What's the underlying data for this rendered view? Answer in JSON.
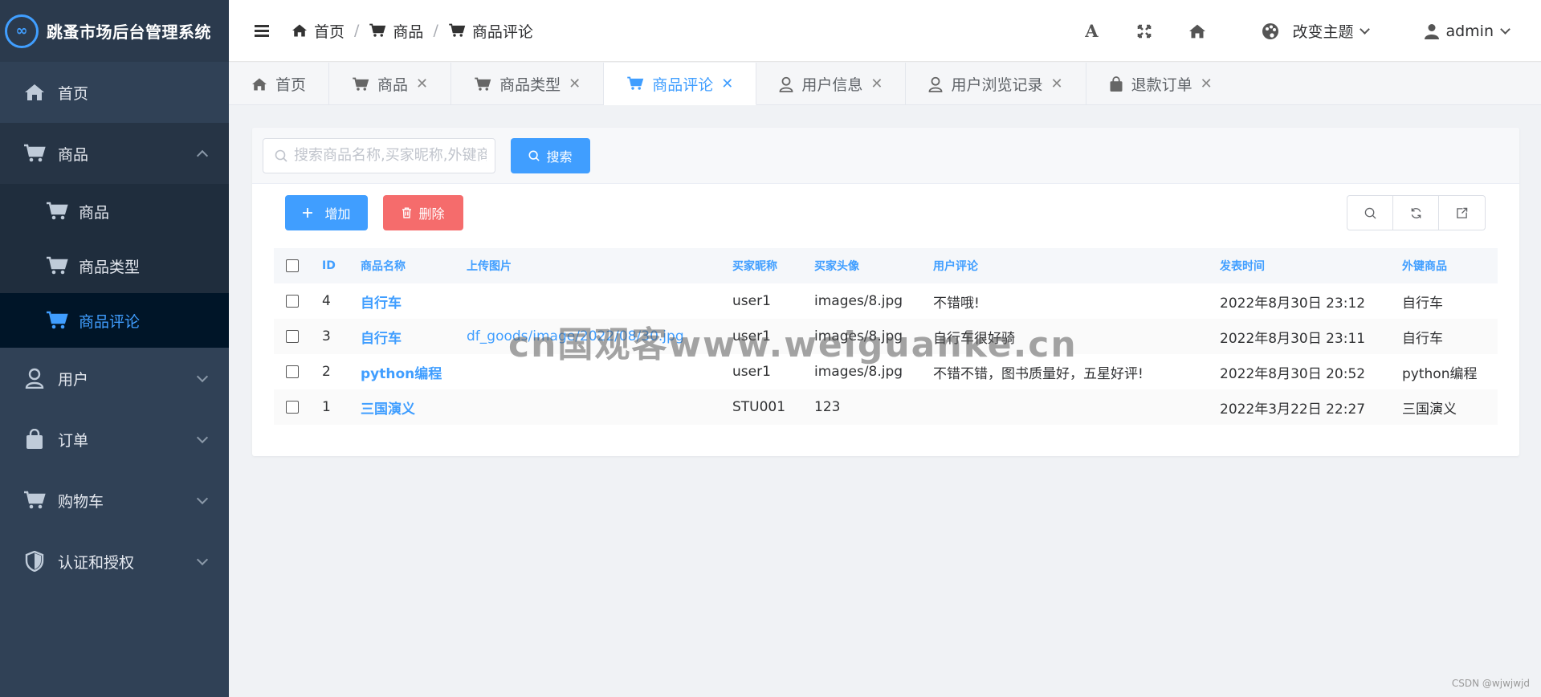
{
  "app": {
    "title": "跳蚤市场后台管理系统",
    "logo": "∞"
  },
  "sidebar": {
    "items": [
      {
        "label": "首页",
        "icon": "home-icon"
      },
      {
        "label": "商品",
        "icon": "cart-icon",
        "expanded": true,
        "children": [
          {
            "label": "商品",
            "icon": "cart-icon"
          },
          {
            "label": "商品类型",
            "icon": "cart-icon"
          },
          {
            "label": "商品评论",
            "icon": "cart-icon",
            "active": true
          }
        ]
      },
      {
        "label": "用户",
        "icon": "user-icon"
      },
      {
        "label": "订单",
        "icon": "bag-icon"
      },
      {
        "label": "购物车",
        "icon": "cart-icon"
      },
      {
        "label": "认证和授权",
        "icon": "shield-icon"
      }
    ]
  },
  "header": {
    "breadcrumb": [
      "首页",
      "商品",
      "商品评论"
    ],
    "theme_label": "改变主题",
    "user_label": "admin"
  },
  "tabs": [
    {
      "label": "首页",
      "icon": "home-icon",
      "closable": false
    },
    {
      "label": "商品",
      "icon": "cart-icon",
      "closable": true
    },
    {
      "label": "商品类型",
      "icon": "cart-icon",
      "closable": true
    },
    {
      "label": "商品评论",
      "icon": "cart-icon",
      "closable": true,
      "active": true
    },
    {
      "label": "用户信息",
      "icon": "user-icon",
      "closable": true
    },
    {
      "label": "用户浏览记录",
      "icon": "user-icon",
      "closable": true
    },
    {
      "label": "退款订单",
      "icon": "bag-icon",
      "closable": true
    }
  ],
  "toolbar": {
    "search_placeholder": "搜索商品名称,买家昵称,外键商",
    "search_label": "搜索",
    "add_label": "增加",
    "delete_label": "删除"
  },
  "table": {
    "columns": [
      "ID",
      "商品名称",
      "上传图片",
      "买家昵称",
      "买家头像",
      "用户评论",
      "发表时间",
      "外键商品"
    ],
    "rows": [
      {
        "id": "4",
        "name": "自行车",
        "image": "",
        "buyer": "user1",
        "avatar": "images/8.jpg",
        "comment": "不错哦!",
        "time": "2022年8月30日 23:12",
        "goods": "自行车"
      },
      {
        "id": "3",
        "name": "自行车",
        "image": "df_goods/image/2022/08/30.jpg",
        "buyer": "user1",
        "avatar": "images/8.jpg",
        "comment": "自行车很好骑",
        "time": "2022年8月30日 23:11",
        "goods": "自行车"
      },
      {
        "id": "2",
        "name": "python编程",
        "image": "",
        "buyer": "user1",
        "avatar": "images/8.jpg",
        "comment": "不错不错，图书质量好，五星好评!",
        "time": "2022年8月30日 20:52",
        "goods": "python编程"
      },
      {
        "id": "1",
        "name": "三国演义",
        "image": "",
        "buyer": "STU001",
        "avatar": "123",
        "comment": "",
        "time": "2022年3月22日 22:27",
        "goods": "三国演义"
      }
    ]
  },
  "watermark": "cn国观客www.weiguanke.cn",
  "footer_credit": "CSDN @wjwjwjd",
  "colors": {
    "primary": "#409eff",
    "danger": "#f56c6c",
    "sidebar": "#304156",
    "sidebar_active": "#001528"
  }
}
